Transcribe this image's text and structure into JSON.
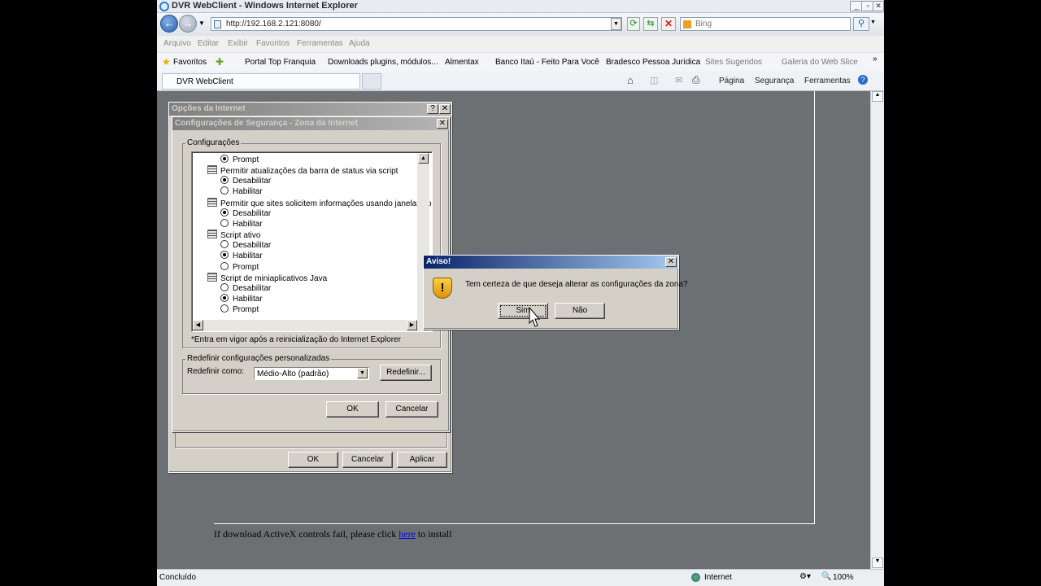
{
  "window": {
    "title": "DVR WebClient - Windows Internet Explorer",
    "url": "http://192.168.2.121:8080/",
    "search_placeholder": "Bing"
  },
  "menu": [
    "Arquivo",
    "Editar",
    "Exibir",
    "Favoritos",
    "Ferramentas",
    "Ajuda"
  ],
  "favorites": {
    "label": "Favoritos",
    "items": [
      "Portal Top Franquia",
      "Downloads plugins, módulos...",
      "Almentax",
      "Banco Itaú - Feito Para Você",
      "Bradesco Pessoa Jurídica",
      "Sites Sugeridos",
      "Galeria do Web Slice"
    ]
  },
  "tab": {
    "label": "DVR WebClient"
  },
  "commandbar": {
    "page": "Página",
    "security": "Segurança",
    "tools": "Ferramentas"
  },
  "page": {
    "activex_text": "If download ActiveX controls fail, please click",
    "link": "here",
    "activex_tail": "to install"
  },
  "statusbar": {
    "status": "Concluído",
    "zone": "Internet",
    "zoom": "100%"
  },
  "internet_options": {
    "title": "Opções da Internet",
    "ok": "OK",
    "cancel": "Cancelar",
    "apply": "Aplicar"
  },
  "security_settings": {
    "title": "Configurações de Segurança - Zona da Internet",
    "settings_group": "Configurações",
    "items": [
      {
        "type": "radio",
        "label": "Prompt",
        "checked": true
      },
      {
        "type": "header",
        "label": "Permitir atualizações da barra de status via script"
      },
      {
        "type": "radio",
        "label": "Desabilitar",
        "checked": true
      },
      {
        "type": "radio",
        "label": "Habilitar",
        "checked": false
      },
      {
        "type": "header",
        "label": "Permitir que sites solicitem informações usando janelas contro"
      },
      {
        "type": "radio",
        "label": "Desabilitar",
        "checked": true
      },
      {
        "type": "radio",
        "label": "Habilitar",
        "checked": false
      },
      {
        "type": "header",
        "label": "Script ativo"
      },
      {
        "type": "radio",
        "label": "Desabilitar",
        "checked": false
      },
      {
        "type": "radio",
        "label": "Habilitar",
        "checked": true
      },
      {
        "type": "radio",
        "label": "Prompt",
        "checked": false
      },
      {
        "type": "header",
        "label": "Script de miniaplicativos Java"
      },
      {
        "type": "radio",
        "label": "Desabilitar",
        "checked": false
      },
      {
        "type": "radio",
        "label": "Habilitar",
        "checked": true
      },
      {
        "type": "radio",
        "label": "Prompt",
        "checked": false
      }
    ],
    "note": "*Entra em vigor após a reinicialização do Internet Explorer",
    "reset_group": "Redefinir configurações personalizadas",
    "reset_label": "Redefinir como:",
    "reset_value": "Médio-Alto (padrão)",
    "reset_button": "Redefinir...",
    "ok": "OK",
    "cancel": "Cancelar"
  },
  "warning": {
    "title": "Aviso!",
    "message": "Tem certeza de que deseja alterar as configurações da zona?",
    "yes": "Sim",
    "no": "Não"
  }
}
